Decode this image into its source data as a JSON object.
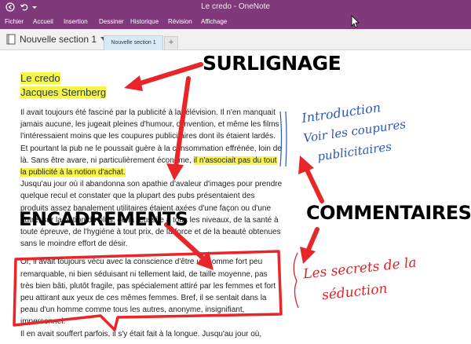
{
  "window": {
    "title": "Le credo - OneNote"
  },
  "ribbon": {
    "tabs": [
      "Fichier",
      "Accueil",
      "Insertion",
      "Dessiner",
      "Historique",
      "Révision",
      "Affichage"
    ]
  },
  "notebook": {
    "current_section": "Nouvelle section 1",
    "active_tab": "Nouvelle section 1",
    "add_tab": "+"
  },
  "note": {
    "title_line1": "Le credo",
    "title_line2": "Jacques Sternberg",
    "paragraph1_a": "Il avait toujours été fasciné par la publicité à la télévision. Il n'en manquait jamais aucune, les jugeait pleines d'humour, d'invention, et même les films l'intéressaient moins que les coupures publicitaires dont ils étaient lardés. Et pourtant la pub ne le poussait guère à la consommation effrénée, loin de là. Sans être avare, ni particulièrement économe, ",
    "paragraph1_highlight": "il n'associait pas du tout la publicité à la notion d'achat.",
    "paragraph2": "Jusqu'au jour où il abandonna son apathie d'avaleur d'images pour prendre quelque recul et constater que la plupart des pubs présentaient des produits assez banalement utilitaires étaient axées d'une façon ou d'une autre, sur la notion du plus, de la réussite à tous les niveaux, de la santé à toute épreuve, de l'hygiène à tout prix, de la force et de la beauté obtenues sans le moindre effort de désir.",
    "paragraph3": "Or, il avait toujours vécu avec la conscience d'être un homme fort peu remarquable, ni bien séduisant ni tellement laid, de taille moyenne, pas très bien bâti, plutôt fragile, pas spécialement attiré par les femmes et fort peu attirant aux yeux de ces mêmes femmes. Bref, il se sentait dans la peau d'un homme comme tous les autres, anonyme, insignifiant, impersonnel.",
    "paragraph4": "Il en avait souffert parfois, il s'y était fait à la longue. Jusqu'au jour où,"
  },
  "annotations": {
    "surlignage": "SURLIGNAGE",
    "encadrements": "ENCADREMENTS",
    "commentaires": "COMMENTAIRES",
    "handwriting_blue_1": "Introduction",
    "handwriting_blue_2": "Voir les coupures",
    "handwriting_blue_3": "publicitaires",
    "handwriting_red_1": "Les secrets de la",
    "handwriting_red_2": "séduction"
  },
  "colors": {
    "title_bar": "#80397b",
    "highlight": "#f7f54a",
    "arrow_red": "#e8262a",
    "handwriting_blue": "#2a58b8",
    "handwriting_red": "#d9252a"
  },
  "icons": {
    "back": "back-arrow-icon",
    "undo": "undo-icon",
    "dropdown": "chevron-down-icon",
    "cursor": "mouse-cursor-icon"
  }
}
